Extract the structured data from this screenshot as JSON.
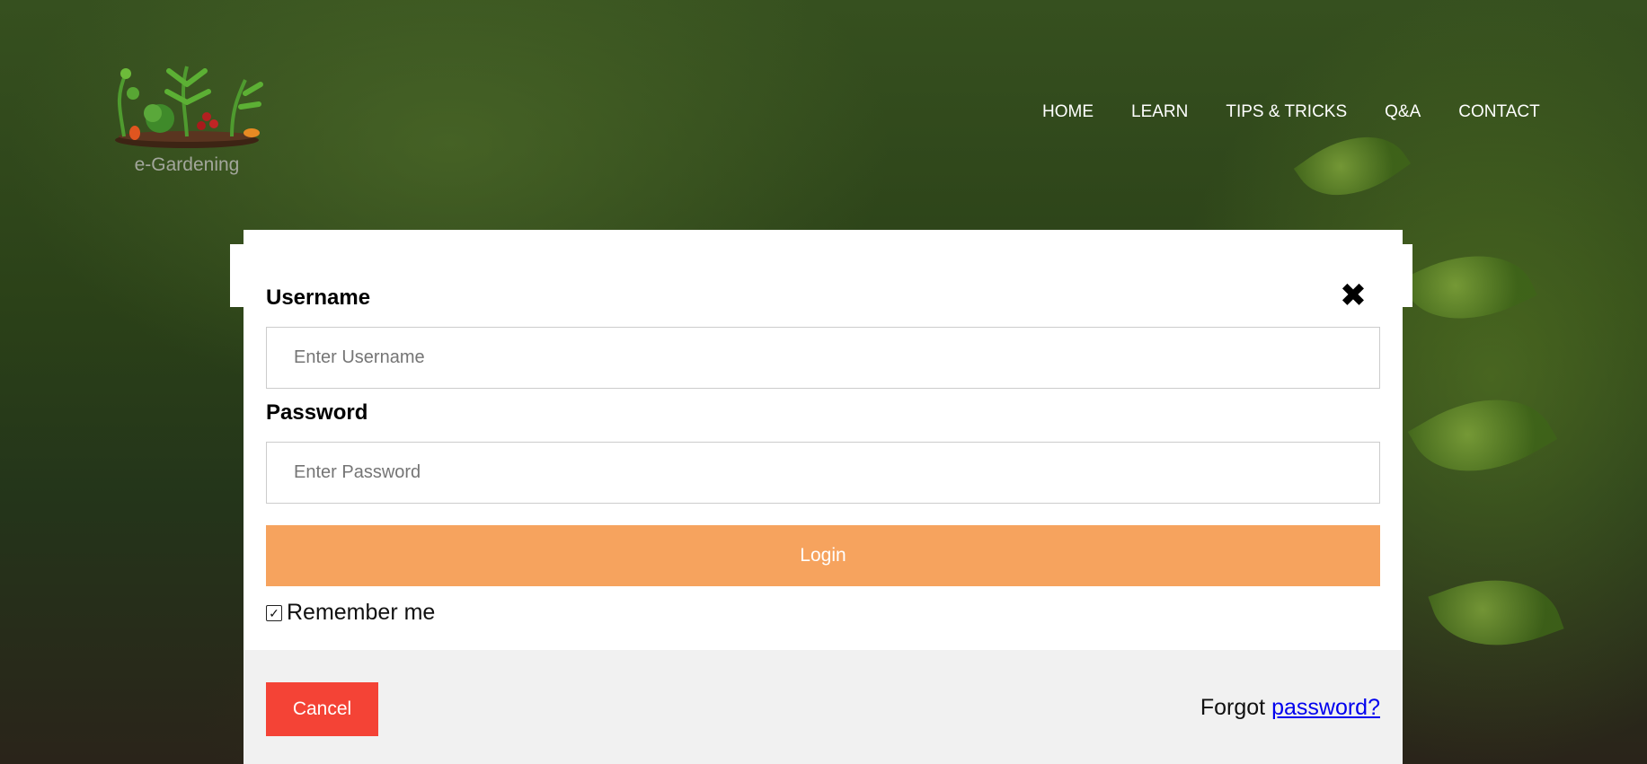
{
  "brand": {
    "logo_icon": "garden-plants-logo",
    "title": "e-Gardening"
  },
  "nav": {
    "items": [
      "HOME",
      "LEARN",
      "TIPS & TRICKS",
      "Q&A",
      "CONTACT"
    ]
  },
  "login": {
    "username_label": "Username",
    "username_placeholder": "Enter Username",
    "username_value": "",
    "password_label": "Password",
    "password_placeholder": "Enter Password",
    "password_value": "",
    "login_button": "Login",
    "remember_label": "Remember me",
    "remember_checked": true,
    "close_icon": "close-icon",
    "cancel_button": "Cancel",
    "forgot_prefix": "Forgot",
    "forgot_link": "password?"
  },
  "colors": {
    "login_button": "#f6a35e",
    "cancel_button": "#f44336",
    "footer_bg": "#f1f1f1",
    "link": "#0000ee"
  }
}
